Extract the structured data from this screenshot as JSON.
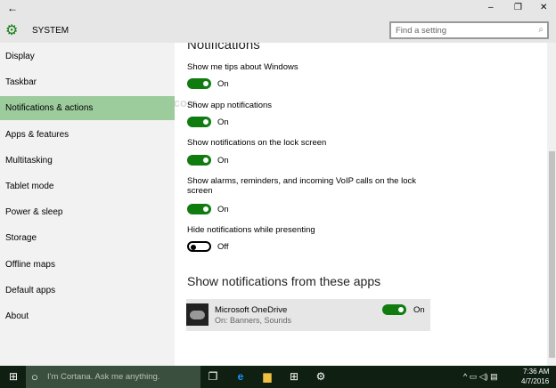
{
  "window": {
    "back": "←",
    "minimize": "–",
    "restore": "❐",
    "close": "✕"
  },
  "header": {
    "title": "SYSTEM",
    "search_placeholder": "Find a setting"
  },
  "sidebar": {
    "items": [
      {
        "label": "Display"
      },
      {
        "label": "Taskbar"
      },
      {
        "label": "Notifications & actions",
        "selected": true
      },
      {
        "label": "Apps & features"
      },
      {
        "label": "Multitasking"
      },
      {
        "label": "Tablet mode"
      },
      {
        "label": "Power & sleep"
      },
      {
        "label": "Storage"
      },
      {
        "label": "Offline maps"
      },
      {
        "label": "Default apps"
      },
      {
        "label": "About"
      }
    ]
  },
  "main": {
    "heading": "Notifications",
    "settings": [
      {
        "label": "Show me tips about Windows",
        "state": "On"
      },
      {
        "label": "Show app notifications",
        "state": "On"
      },
      {
        "label": "Show notifications on the lock screen",
        "state": "On"
      },
      {
        "label": "Show alarms, reminders, and incoming VoIP calls on the lock screen",
        "state": "On"
      },
      {
        "label": "Hide notifications while presenting",
        "state": "Off"
      }
    ],
    "apps_heading": "Show notifications from these apps",
    "apps": [
      {
        "name": "Microsoft OneDrive",
        "detail": "On: Banners, Sounds",
        "state": "On"
      }
    ]
  },
  "watermark": "http://winaero.com",
  "taskbar": {
    "cortana_placeholder": "I'm Cortana. Ask me anything.",
    "time": "7:36 AM",
    "date": "4/7/2016"
  },
  "colors": {
    "accent": "#107c10",
    "selected": "#9ccc9c",
    "taskbar": "#0f1f12"
  }
}
